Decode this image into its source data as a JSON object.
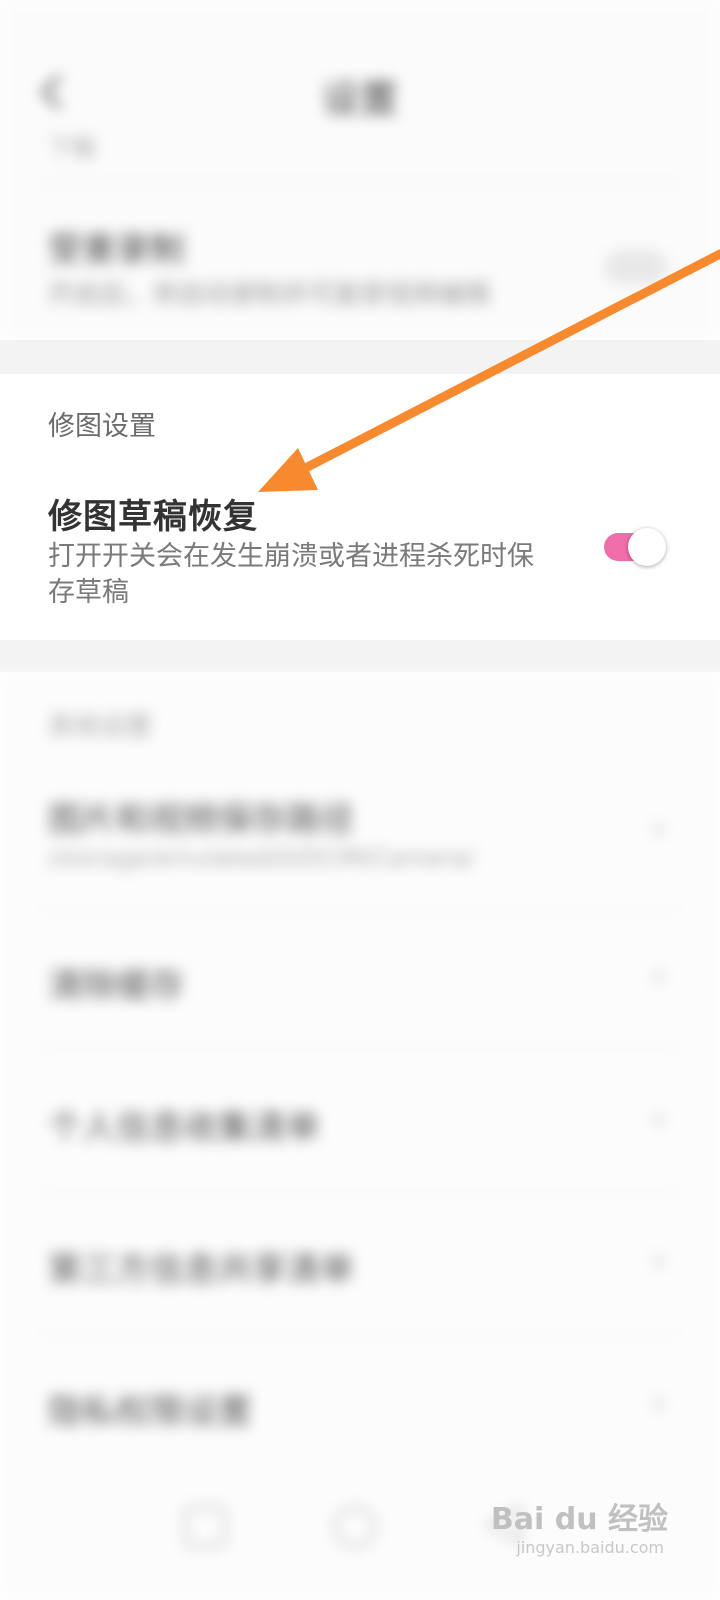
{
  "header": {
    "title": "设置",
    "back_icon": "chevron-left-icon"
  },
  "top_section": {
    "subtext": "下载",
    "row": {
      "title": "受害录制",
      "description": "开启后，将自动录制并可复原视频编辑"
    }
  },
  "edit_settings": {
    "section_title": "修图设置",
    "item": {
      "title": "修图草稿恢复",
      "description": "打开开关会在发生崩溃或者进程杀死时保存草稿",
      "toggle_on": true
    }
  },
  "other_settings": {
    "section_title": "其他设置",
    "items": [
      {
        "title": "图片和视频保存路径",
        "subtitle": "/storage/emulated/0/DCIM/Camera/"
      },
      {
        "title": "清除缓存",
        "subtitle": ""
      },
      {
        "title": "个人信息收集清单",
        "subtitle": ""
      },
      {
        "title": "第三方信息共享清单",
        "subtitle": ""
      },
      {
        "title": "隐私权限设置",
        "subtitle": ""
      }
    ]
  },
  "bottom_nav": {
    "icons": [
      "square-icon",
      "circle-icon",
      "back-triangle-icon"
    ]
  },
  "watermark": {
    "brand": "Bai du 经验",
    "url": "jingyan.baidu.com"
  },
  "colors": {
    "accent_pink": "#f06ea9",
    "arrow_orange": "#f7892f"
  }
}
